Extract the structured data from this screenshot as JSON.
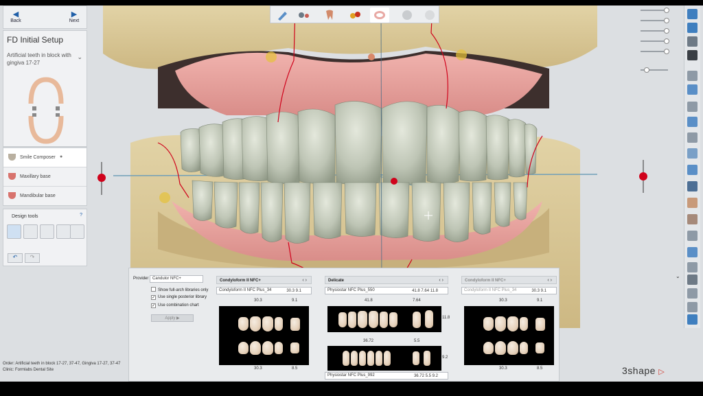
{
  "nav": {
    "back": "Back",
    "next": "Next"
  },
  "step": {
    "title": "FD Initial Setup",
    "subtitle": "Artificial teeth in block with gingiva 17-27"
  },
  "steps": [
    {
      "label": "Smile Composer",
      "active": true
    },
    {
      "label": "Maxillary base",
      "active": false
    },
    {
      "label": "Mandibular base",
      "active": false
    }
  ],
  "design_tools": {
    "title": "Design tools",
    "help": "?"
  },
  "library": {
    "provider_label": "Provider",
    "provider_value": "Candulor NFC+",
    "options": [
      {
        "label": "Show full-arch libraries only",
        "checked": false
      },
      {
        "label": "Use single posterior library",
        "checked": true
      },
      {
        "label": "Use combination chart",
        "checked": true
      }
    ],
    "apply_label": "Apply",
    "cards": [
      {
        "header": "Condyloform II NFC+",
        "select": "Condyloform II NFC Plus_34",
        "values": "30.3  9.1",
        "dims_top": [
          "30.3",
          "9.1"
        ],
        "dims_bottom": [
          "30.3",
          "8.5"
        ]
      },
      {
        "header": "Delicate",
        "select": "Physiostar NFC Plus_550",
        "values": "41.8  7.64  11.8",
        "dims_top": [
          "41.8",
          "7.64"
        ],
        "side_dim": "11.8",
        "dims_mid": [
          "36.72",
          "5.5"
        ],
        "side_dim2": "9.2",
        "select2": "Physiostar NFC Plus_992",
        "values2": "36.72  5.5  9.2"
      },
      {
        "header": "Condyloform II NFC+",
        "select": "Condyloform II NFC Plus_34",
        "values": "30.3  9.1",
        "dims_top": [
          "30.3",
          "9.1"
        ],
        "dims_bottom": [
          "30.3",
          "8.5"
        ]
      }
    ]
  },
  "footer": {
    "order": "Order:   Artificial teeth in block 17-27, 37-47, Gingiva 17-27, 37-47",
    "clinic": "Clinic:   Formlabs Dental Site"
  },
  "brand": "3shape",
  "colors": {
    "accent_blue": "#1f5fa8",
    "gingiva": "#e9a3a0",
    "model_base": "#dcc99a",
    "tooth": "#c9cfc0",
    "marker_red": "#d0021b"
  }
}
